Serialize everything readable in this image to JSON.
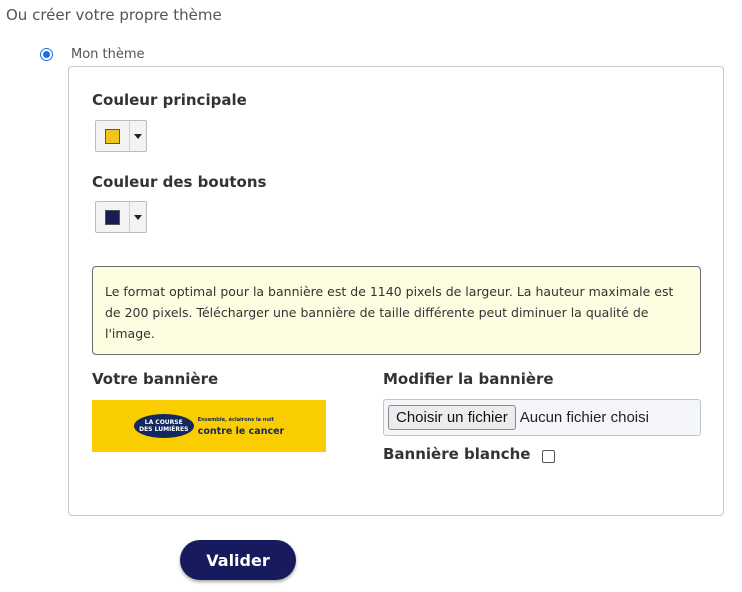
{
  "section_heading": "Ou créer votre propre thème",
  "theme_option": {
    "label": "Mon thème",
    "selected": true
  },
  "primary_color": {
    "label": "Couleur principale",
    "value": "#f0c419"
  },
  "button_color": {
    "label": "Couleur des boutons",
    "value": "#1b1a52"
  },
  "notice": "Le format optimal pour la bannière est de 1140 pixels de largeur. La hauteur maximale est de 200 pixels. Télécharger une bannière de taille différente peut diminuer la qualité de l'image.",
  "banner": {
    "label": "Votre bannière",
    "logo_line1": "LA COURSE",
    "logo_line2": "DES LUMIÈRES",
    "logo_tagline": "Ensemble, éclairons la nuit",
    "logo_slogan": "contre le cancer"
  },
  "modify_banner": {
    "label": "Modifier la bannière",
    "file_button": "Choisir un fichier",
    "file_status": "Aucun fichier choisi"
  },
  "white_banner": {
    "label": "Bannière blanche",
    "checked": false
  },
  "submit_label": "Valider"
}
